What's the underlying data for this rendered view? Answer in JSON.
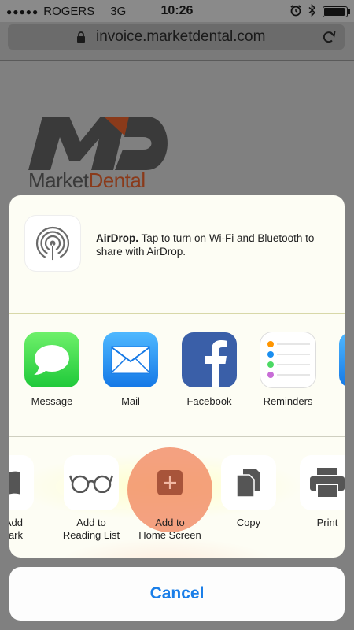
{
  "status_bar": {
    "signal_dots": "●●●●●",
    "carrier": "ROGERS",
    "network": "3G",
    "time": "10:26"
  },
  "url_bar": {
    "url": "invoice.marketdental.com"
  },
  "logo": {
    "market": "Market",
    "dental": "Dental"
  },
  "share_sheet": {
    "airdrop": {
      "title": "AirDrop.",
      "message": " Tap to turn on Wi-Fi and Bluetooth to share with AirDrop."
    },
    "apps": [
      {
        "label": "Message",
        "icon": "message-icon"
      },
      {
        "label": "Mail",
        "icon": "mail-icon"
      },
      {
        "label": "Facebook",
        "icon": "facebook-icon"
      },
      {
        "label": "Reminders",
        "icon": "reminders-icon"
      }
    ],
    "actions": [
      {
        "label": "Add Bookmark",
        "line1": "Add",
        "line2": "kmark",
        "icon": "bookmark-icon"
      },
      {
        "label": "Add to Reading List",
        "line1": "Add to",
        "line2": "Reading List",
        "icon": "glasses-icon"
      },
      {
        "label": "Add to Home Screen",
        "line1": "Add to",
        "line2": "Home Screen",
        "icon": "add-icon"
      },
      {
        "label": "Copy",
        "line1": "Copy",
        "line2": "",
        "icon": "copy-icon"
      },
      {
        "label": "Print",
        "line1": "Print",
        "line2": "",
        "icon": "print-icon"
      }
    ]
  },
  "cancel_button": {
    "label": "Cancel"
  },
  "colors": {
    "accent": "#1a7ee8",
    "highlight": "#f0825a",
    "brand_dark": "#3a3a3a",
    "brand_rust": "#8a3a1a"
  }
}
